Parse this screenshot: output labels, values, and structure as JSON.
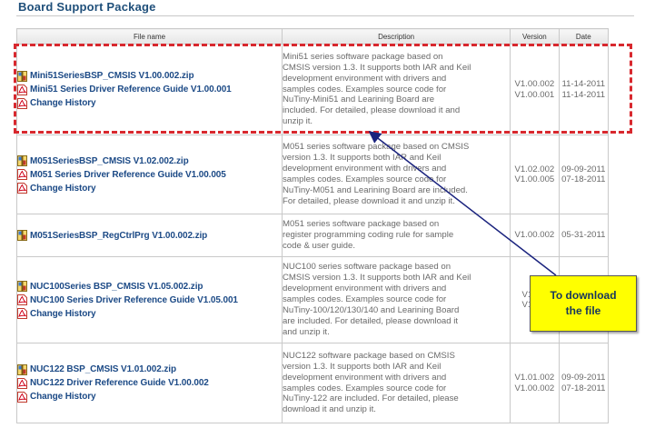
{
  "section": {
    "title": "Board Support Package"
  },
  "columns": {
    "file": "File name",
    "description": "Description",
    "version": "Version",
    "date": "Date"
  },
  "rows": [
    {
      "files": [
        "Mini51SeriesBSP_CMSIS V1.00.002.zip",
        "Mini51 Series Driver Reference Guide V1.00.001",
        "Change History"
      ],
      "icons": [
        "zip-icon",
        "pdf-icon",
        "pdf-icon"
      ],
      "description": [
        "Mini51 series software package based on",
        "CMSIS version 1.3. It supports both IAR and Keil",
        "development environment with drivers and",
        "samples codes. Examples source code for",
        "NuTiny-Mini51 and Learining Board are",
        "included. For detailed, please download it and",
        "unzip it."
      ],
      "versions": [
        "V1.00.002",
        "V1.00.001"
      ],
      "dates": [
        "11-14-2011",
        "11-14-2011"
      ]
    },
    {
      "files": [
        "M051SeriesBSP_CMSIS V1.02.002.zip",
        "M051 Series Driver Reference Guide V1.00.005",
        "Change History"
      ],
      "icons": [
        "zip-icon",
        "pdf-icon",
        "pdf-icon"
      ],
      "description": [
        "M051 series software package based on CMSIS",
        "version 1.3. It supports both IAR and Keil",
        "development environment with drivers and",
        "samples codes. Examples source code for",
        "NuTiny-M051 and Learining Board are included.",
        "For detailed, please download it and unzip it."
      ],
      "versions": [
        "V1.02.002",
        "V1.00.005"
      ],
      "dates": [
        "09-09-2011",
        "07-18-2011"
      ]
    },
    {
      "files": [
        "M051SeriesBSP_RegCtrlPrg V1.00.002.zip"
      ],
      "icons": [
        "zip-icon"
      ],
      "description": [
        "M051 series software package based on",
        "register programming coding rule for sample",
        "code & user guide."
      ],
      "versions": [
        "V1.00.002"
      ],
      "dates": [
        "05-31-2011"
      ]
    },
    {
      "files": [
        "NUC100Series BSP_CMSIS V1.05.002.zip",
        "NUC100 Series Driver Reference Guide V1.05.001",
        "Change History"
      ],
      "icons": [
        "zip-icon",
        "pdf-icon",
        "pdf-icon"
      ],
      "description": [
        "NUC100 series software package based on",
        "CMSIS version 1.3. It supports both IAR and Keil",
        "development environment with drivers and",
        "samples codes. Examples source code for",
        "NuTiny-100/120/130/140 and Learining Board",
        "are included. For detailed, please download it",
        "and unzip it."
      ],
      "versions": [
        "V1.05.",
        "V1.05."
      ],
      "dates": [
        "",
        ""
      ]
    },
    {
      "files": [
        "NUC122 BSP_CMSIS V1.01.002.zip",
        "NUC122 Driver Reference Guide V1.00.002",
        "Change History"
      ],
      "icons": [
        "zip-icon",
        "pdf-icon",
        "pdf-icon"
      ],
      "description": [
        "NUC122 software package based on CMSIS",
        "version 1.3. It supports both IAR and Keil",
        "development environment with drivers and",
        "samples codes. Examples source code for",
        "NuTiny-122 are included. For detailed, please",
        "download it and unzip it."
      ],
      "versions": [
        "V1.01.002",
        "V1.00.002"
      ],
      "dates": [
        "09-09-2011",
        "07-18-2011"
      ]
    }
  ],
  "callout": {
    "line1": "To download",
    "line2": "the file"
  },
  "colors": {
    "link": "#1c4a86",
    "highlight": "#d8282e",
    "callout_bg": "#ffff00",
    "arrow": "#1a237e"
  }
}
